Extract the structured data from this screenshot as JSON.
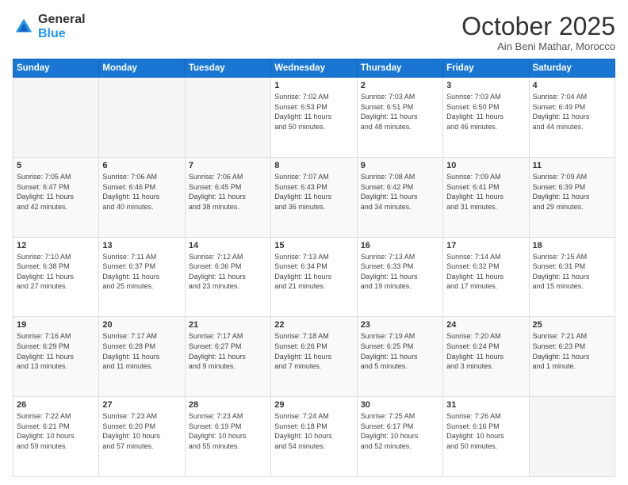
{
  "header": {
    "logo_general": "General",
    "logo_blue": "Blue",
    "month_title": "October 2025",
    "location": "Ain Beni Mathar, Morocco"
  },
  "weekdays": [
    "Sunday",
    "Monday",
    "Tuesday",
    "Wednesday",
    "Thursday",
    "Friday",
    "Saturday"
  ],
  "weeks": [
    [
      {
        "day": "",
        "info": ""
      },
      {
        "day": "",
        "info": ""
      },
      {
        "day": "",
        "info": ""
      },
      {
        "day": "1",
        "info": "Sunrise: 7:02 AM\nSunset: 6:53 PM\nDaylight: 11 hours\nand 50 minutes."
      },
      {
        "day": "2",
        "info": "Sunrise: 7:03 AM\nSunset: 6:51 PM\nDaylight: 11 hours\nand 48 minutes."
      },
      {
        "day": "3",
        "info": "Sunrise: 7:03 AM\nSunset: 6:50 PM\nDaylight: 11 hours\nand 46 minutes."
      },
      {
        "day": "4",
        "info": "Sunrise: 7:04 AM\nSunset: 6:49 PM\nDaylight: 11 hours\nand 44 minutes."
      }
    ],
    [
      {
        "day": "5",
        "info": "Sunrise: 7:05 AM\nSunset: 6:47 PM\nDaylight: 11 hours\nand 42 minutes."
      },
      {
        "day": "6",
        "info": "Sunrise: 7:06 AM\nSunset: 6:46 PM\nDaylight: 11 hours\nand 40 minutes."
      },
      {
        "day": "7",
        "info": "Sunrise: 7:06 AM\nSunset: 6:45 PM\nDaylight: 11 hours\nand 38 minutes."
      },
      {
        "day": "8",
        "info": "Sunrise: 7:07 AM\nSunset: 6:43 PM\nDaylight: 11 hours\nand 36 minutes."
      },
      {
        "day": "9",
        "info": "Sunrise: 7:08 AM\nSunset: 6:42 PM\nDaylight: 11 hours\nand 34 minutes."
      },
      {
        "day": "10",
        "info": "Sunrise: 7:09 AM\nSunset: 6:41 PM\nDaylight: 11 hours\nand 31 minutes."
      },
      {
        "day": "11",
        "info": "Sunrise: 7:09 AM\nSunset: 6:39 PM\nDaylight: 11 hours\nand 29 minutes."
      }
    ],
    [
      {
        "day": "12",
        "info": "Sunrise: 7:10 AM\nSunset: 6:38 PM\nDaylight: 11 hours\nand 27 minutes."
      },
      {
        "day": "13",
        "info": "Sunrise: 7:11 AM\nSunset: 6:37 PM\nDaylight: 11 hours\nand 25 minutes."
      },
      {
        "day": "14",
        "info": "Sunrise: 7:12 AM\nSunset: 6:36 PM\nDaylight: 11 hours\nand 23 minutes."
      },
      {
        "day": "15",
        "info": "Sunrise: 7:13 AM\nSunset: 6:34 PM\nDaylight: 11 hours\nand 21 minutes."
      },
      {
        "day": "16",
        "info": "Sunrise: 7:13 AM\nSunset: 6:33 PM\nDaylight: 11 hours\nand 19 minutes."
      },
      {
        "day": "17",
        "info": "Sunrise: 7:14 AM\nSunset: 6:32 PM\nDaylight: 11 hours\nand 17 minutes."
      },
      {
        "day": "18",
        "info": "Sunrise: 7:15 AM\nSunset: 6:31 PM\nDaylight: 11 hours\nand 15 minutes."
      }
    ],
    [
      {
        "day": "19",
        "info": "Sunrise: 7:16 AM\nSunset: 6:29 PM\nDaylight: 11 hours\nand 13 minutes."
      },
      {
        "day": "20",
        "info": "Sunrise: 7:17 AM\nSunset: 6:28 PM\nDaylight: 11 hours\nand 11 minutes."
      },
      {
        "day": "21",
        "info": "Sunrise: 7:17 AM\nSunset: 6:27 PM\nDaylight: 11 hours\nand 9 minutes."
      },
      {
        "day": "22",
        "info": "Sunrise: 7:18 AM\nSunset: 6:26 PM\nDaylight: 11 hours\nand 7 minutes."
      },
      {
        "day": "23",
        "info": "Sunrise: 7:19 AM\nSunset: 6:25 PM\nDaylight: 11 hours\nand 5 minutes."
      },
      {
        "day": "24",
        "info": "Sunrise: 7:20 AM\nSunset: 6:24 PM\nDaylight: 11 hours\nand 3 minutes."
      },
      {
        "day": "25",
        "info": "Sunrise: 7:21 AM\nSunset: 6:23 PM\nDaylight: 11 hours\nand 1 minute."
      }
    ],
    [
      {
        "day": "26",
        "info": "Sunrise: 7:22 AM\nSunset: 6:21 PM\nDaylight: 10 hours\nand 59 minutes."
      },
      {
        "day": "27",
        "info": "Sunrise: 7:23 AM\nSunset: 6:20 PM\nDaylight: 10 hours\nand 57 minutes."
      },
      {
        "day": "28",
        "info": "Sunrise: 7:23 AM\nSunset: 6:19 PM\nDaylight: 10 hours\nand 55 minutes."
      },
      {
        "day": "29",
        "info": "Sunrise: 7:24 AM\nSunset: 6:18 PM\nDaylight: 10 hours\nand 54 minutes."
      },
      {
        "day": "30",
        "info": "Sunrise: 7:25 AM\nSunset: 6:17 PM\nDaylight: 10 hours\nand 52 minutes."
      },
      {
        "day": "31",
        "info": "Sunrise: 7:26 AM\nSunset: 6:16 PM\nDaylight: 10 hours\nand 50 minutes."
      },
      {
        "day": "",
        "info": ""
      }
    ]
  ]
}
